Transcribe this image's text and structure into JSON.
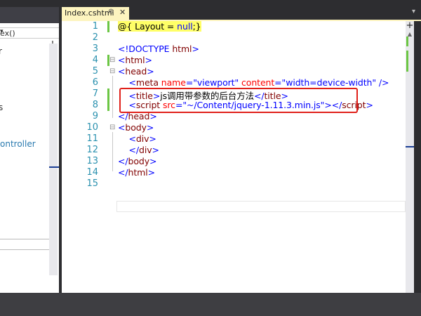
{
  "tab": {
    "label": "Index.cshtml",
    "pin_icon": "pin-icon",
    "close_icon": "close-icon"
  },
  "left_panel": {
    "dropdown_text": "ex()",
    "hint1": "r",
    "hint2": "s",
    "controller_text": "ontroller"
  },
  "editor": {
    "line_numbers": [
      "1",
      "2",
      "3",
      "4",
      "5",
      "6",
      "7",
      "8",
      "9",
      "10",
      "11",
      "12",
      "13",
      "14",
      "15"
    ],
    "lines": [
      [
        {
          "t": "@{ ",
          "c": "c-razor"
        },
        {
          "t": "Layout",
          "c": "c-razor"
        },
        {
          "t": " = ",
          "c": "c-razor"
        },
        {
          "t": "null",
          "c": "c-razor c-kw"
        },
        {
          "t": ";}",
          "c": "c-razor"
        }
      ],
      [],
      [
        {
          "t": "<!DOCTYPE ",
          "c": "c-br"
        },
        {
          "t": "html",
          "c": "c-tag"
        },
        {
          "t": ">",
          "c": "c-br"
        }
      ],
      [
        {
          "t": "<",
          "c": "c-br"
        },
        {
          "t": "html",
          "c": "c-tag"
        },
        {
          "t": ">",
          "c": "c-br"
        }
      ],
      [
        {
          "t": "<",
          "c": "c-br"
        },
        {
          "t": "head",
          "c": "c-tag"
        },
        {
          "t": ">",
          "c": "c-br"
        }
      ],
      [
        {
          "t": "    <",
          "c": "c-br"
        },
        {
          "t": "meta ",
          "c": "c-tag"
        },
        {
          "t": "name",
          "c": "c-attr"
        },
        {
          "t": "=",
          "c": "c-br"
        },
        {
          "t": "\"viewport\" ",
          "c": "c-val"
        },
        {
          "t": "content",
          "c": "c-attr"
        },
        {
          "t": "=",
          "c": "c-br"
        },
        {
          "t": "\"width=device-width\" ",
          "c": "c-val"
        },
        {
          "t": "/>",
          "c": "c-br"
        }
      ],
      [
        {
          "t": "    <",
          "c": "c-br"
        },
        {
          "t": "title",
          "c": "c-tag"
        },
        {
          "t": ">",
          "c": "c-br"
        },
        {
          "t": "js调用带参数的后台方法",
          "c": "c-text"
        },
        {
          "t": "</",
          "c": "c-br"
        },
        {
          "t": "title",
          "c": "c-tag"
        },
        {
          "t": ">",
          "c": "c-br"
        }
      ],
      [
        {
          "t": "    <",
          "c": "c-br"
        },
        {
          "t": "script ",
          "c": "c-tag"
        },
        {
          "t": "src",
          "c": "c-attr"
        },
        {
          "t": "=",
          "c": "c-br"
        },
        {
          "t": "\"~/Content/jquery-1.11.3.min.js\"",
          "c": "c-val"
        },
        {
          "t": "></",
          "c": "c-br"
        },
        {
          "t": "script",
          "c": "c-tag"
        },
        {
          "t": ">",
          "c": "c-br"
        }
      ],
      [
        {
          "t": "</",
          "c": "c-br"
        },
        {
          "t": "head",
          "c": "c-tag"
        },
        {
          "t": ">",
          "c": "c-br"
        }
      ],
      [
        {
          "t": "<",
          "c": "c-br"
        },
        {
          "t": "body",
          "c": "c-tag"
        },
        {
          "t": ">",
          "c": "c-br"
        }
      ],
      [
        {
          "t": "    <",
          "c": "c-br"
        },
        {
          "t": "div",
          "c": "c-tag"
        },
        {
          "t": ">",
          "c": "c-br"
        }
      ],
      [
        {
          "t": "    </",
          "c": "c-br"
        },
        {
          "t": "div",
          "c": "c-tag"
        },
        {
          "t": ">",
          "c": "c-br"
        }
      ],
      [
        {
          "t": "</",
          "c": "c-br"
        },
        {
          "t": "body",
          "c": "c-tag"
        },
        {
          "t": ">",
          "c": "c-br"
        }
      ],
      [
        {
          "t": "</",
          "c": "c-br"
        },
        {
          "t": "html",
          "c": "c-tag"
        },
        {
          "t": ">",
          "c": "c-br"
        }
      ],
      []
    ]
  },
  "colors": {
    "accent_tab": "#fdf4bf",
    "highlight_box": "#e0201a",
    "change_bar": "#6cc644",
    "line_number": "#2b91af"
  }
}
